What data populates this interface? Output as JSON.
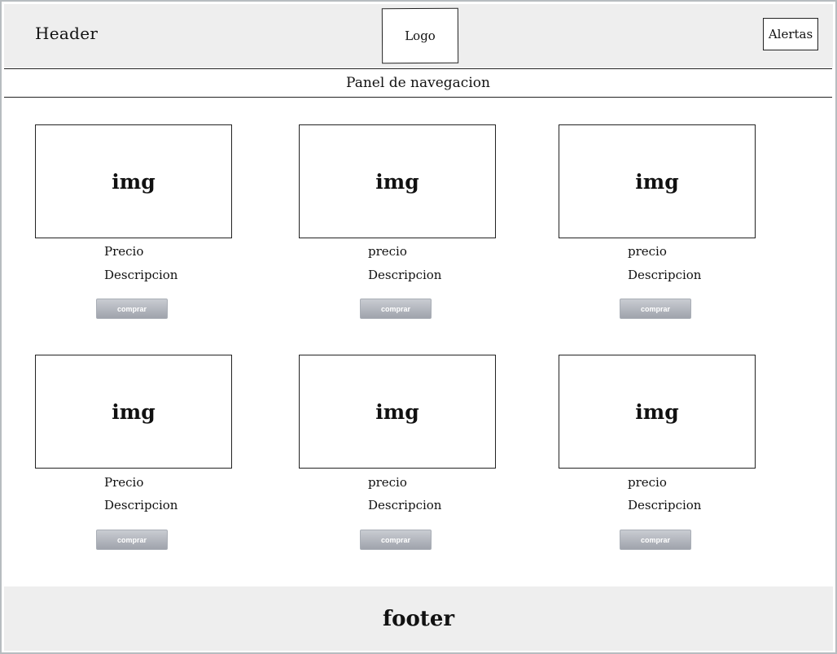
{
  "header": {
    "title": "Header",
    "logo_label": "Logo",
    "alerts_label": "Alertas"
  },
  "nav": {
    "label": "Panel de navegacion"
  },
  "products": [
    {
      "image_label": "img",
      "price_label": "Precio",
      "description_label": "Descripcion",
      "button_label": "comprar"
    },
    {
      "image_label": "img",
      "price_label": "precio",
      "description_label": "Descripcion",
      "button_label": "comprar"
    },
    {
      "image_label": "img",
      "price_label": "precio",
      "description_label": "Descripcion",
      "button_label": "comprar"
    },
    {
      "image_label": "img",
      "price_label": "Precio",
      "description_label": "Descripcion",
      "button_label": "comprar"
    },
    {
      "image_label": "img",
      "price_label": "precio",
      "description_label": "Descripcion",
      "button_label": "comprar"
    },
    {
      "image_label": "img",
      "price_label": "precio",
      "description_label": "Descripcion",
      "button_label": "comprar"
    }
  ],
  "footer": {
    "label": "footer"
  },
  "colors": {
    "header_bg": "#eeeeee",
    "footer_bg": "#eeeeee",
    "button_gradient_top": "#c9ccd2",
    "button_gradient_bottom": "#9fa3ac",
    "frame_border": "#b7bcc0"
  }
}
